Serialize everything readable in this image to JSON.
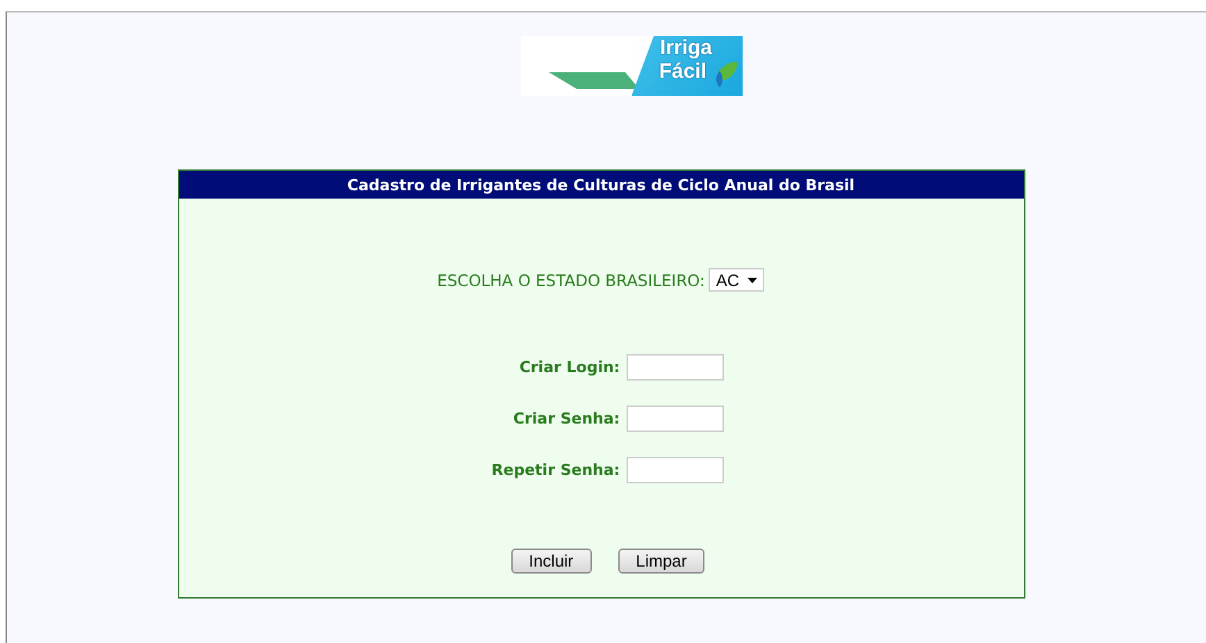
{
  "logo": {
    "line_1": "Irriga",
    "line_2": "Fácil"
  },
  "form": {
    "title": "Cadastro de Irrigantes de Culturas de Ciclo Anual do Brasil",
    "state_label": "ESCOLHA O ESTADO BRASILEIRO:",
    "state_value": "AC",
    "fields": [
      {
        "label": "Criar Login:"
      },
      {
        "label": "Criar Senha:"
      },
      {
        "label": "Repetir Senha:"
      }
    ],
    "buttons": [
      "Incluir",
      "Limpar"
    ]
  }
}
